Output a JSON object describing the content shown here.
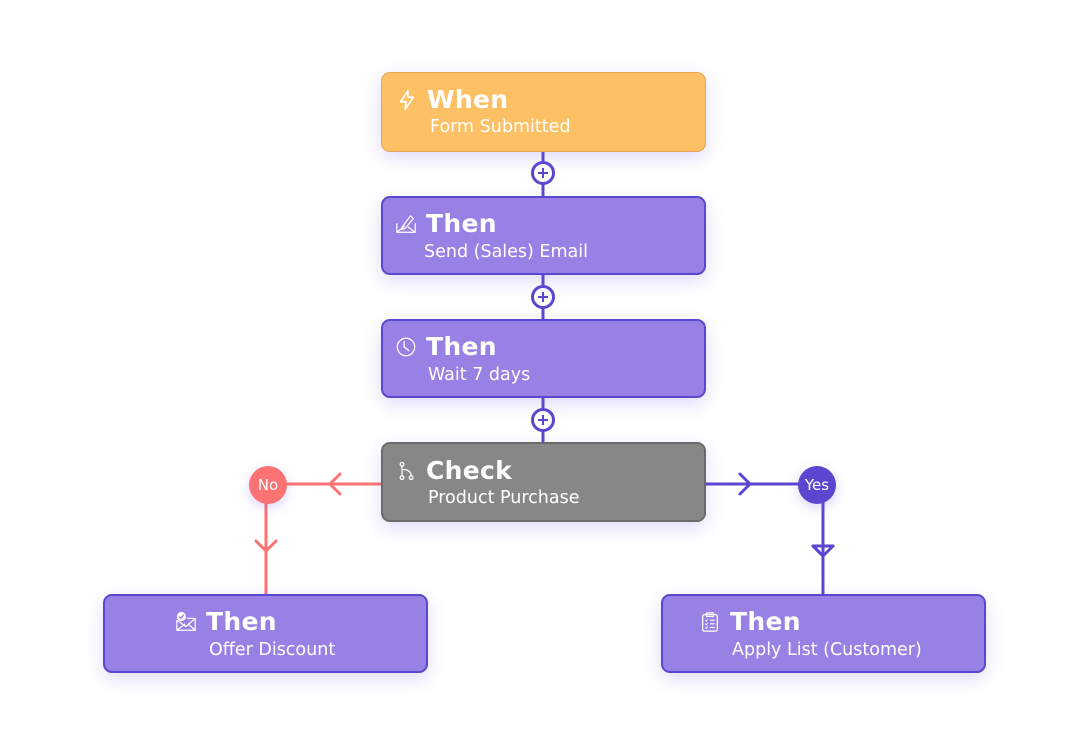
{
  "colors": {
    "trigger": "#fdc064",
    "action": "#9880e5",
    "action_border": "#5a47cf",
    "check": "#878787",
    "no_branch": "#fd7272",
    "yes_branch": "#5a47cf"
  },
  "nodes": {
    "when": {
      "icon": "lightning-icon",
      "title": "When",
      "subtitle": "Form Submitted"
    },
    "send_email": {
      "icon": "email-edit-icon",
      "title": "Then",
      "subtitle": "Send (Sales) Email"
    },
    "wait": {
      "icon": "clock-icon",
      "title": "Then",
      "subtitle": "Wait 7 days"
    },
    "check": {
      "icon": "branch-icon",
      "title": "Check",
      "subtitle": "Product Purchase"
    },
    "offer_discount": {
      "icon": "email-check-icon",
      "title": "Then",
      "subtitle": "Offer Discount"
    },
    "apply_list": {
      "icon": "clipboard-list-icon",
      "title": "Then",
      "subtitle": "Apply List (Customer)"
    }
  },
  "connectors": {
    "add_step_icon": "plus-circle-icon",
    "branches": {
      "no": {
        "label": "No"
      },
      "yes": {
        "label": "Yes"
      }
    }
  }
}
